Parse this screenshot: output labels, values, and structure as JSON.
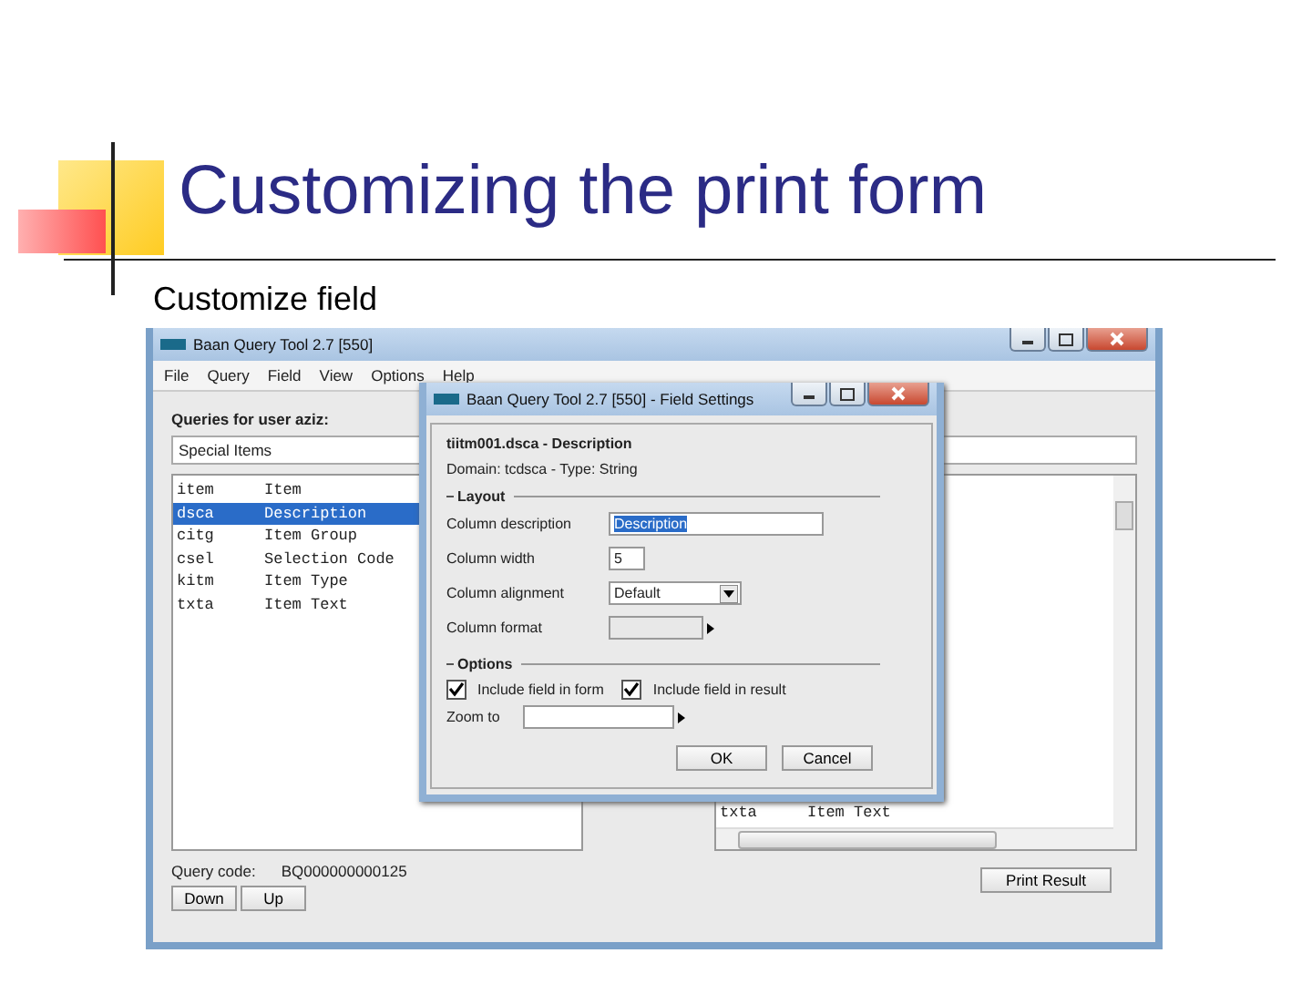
{
  "slide": {
    "title": "Customizing the print form",
    "subtitle": "Customize field"
  },
  "main_window": {
    "title": "Baan Query Tool 2.7 [550]",
    "menu": [
      "File",
      "Query",
      "Field",
      "View",
      "Options",
      "Help"
    ],
    "queries_label": "Queries for user aziz:",
    "query_field": "Special Items",
    "fields": [
      {
        "code": "item",
        "description": "Item",
        "selected": false
      },
      {
        "code": "dsca",
        "description": "Description",
        "selected": true
      },
      {
        "code": "citg",
        "description": "Item Group",
        "selected": false
      },
      {
        "code": "csel",
        "description": "Selection Code",
        "selected": false
      },
      {
        "code": "kitm",
        "description": "Item Type",
        "selected": false
      },
      {
        "code": "txta",
        "description": "Item Text",
        "selected": false
      }
    ],
    "result_list": [
      {
        "code": "txta",
        "description": "Item Text"
      }
    ],
    "query_code_label": "Query code:",
    "query_code": "BQ000000000125",
    "buttons": [
      "Down",
      "Up"
    ],
    "print_button": "Print Result"
  },
  "dialog": {
    "title": "Baan Query Tool 2.7 [550] - Field Settings",
    "field_heading": "tiitm001.dsca - Description",
    "domain": "Domain: tcdsca - Type: String",
    "layout_heading": "Layout",
    "rows": [
      {
        "kind": "text",
        "label": "Column description",
        "value": "Description"
      },
      {
        "kind": "number",
        "label": "Column width",
        "value": "5"
      },
      {
        "kind": "select",
        "label": "Column alignment",
        "value": "Default"
      },
      {
        "kind": "zoom",
        "label": "Column format"
      }
    ],
    "options_heading": "Options",
    "checkboxes": [
      {
        "label": "Include field in form",
        "checked": true
      },
      {
        "label": "Include field in result",
        "checked": true
      }
    ],
    "zoom_label": "Zoom to",
    "buttons": [
      "OK",
      "Cancel"
    ]
  }
}
